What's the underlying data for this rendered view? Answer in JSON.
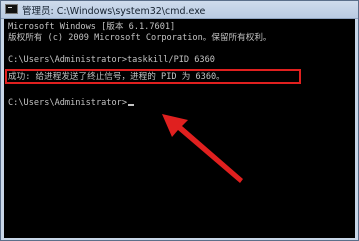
{
  "window": {
    "title": "管理员: C:\\Windows\\system32\\cmd.exe"
  },
  "console": {
    "lines": [
      "Microsoft Windows [版本 6.1.7601]",
      "版权所有 (c) 2009 Microsoft Corporation。保留所有权利。",
      "",
      "C:\\Users\\Administrator>taskkill/PID 6360",
      "成功: 给进程发送了终止信号，进程的 PID 为 6360。",
      "",
      "C:\\Users\\Administrator>"
    ]
  },
  "annotation": {
    "highlight_color": "#e0201f",
    "arrow_color": "#e0201f"
  }
}
